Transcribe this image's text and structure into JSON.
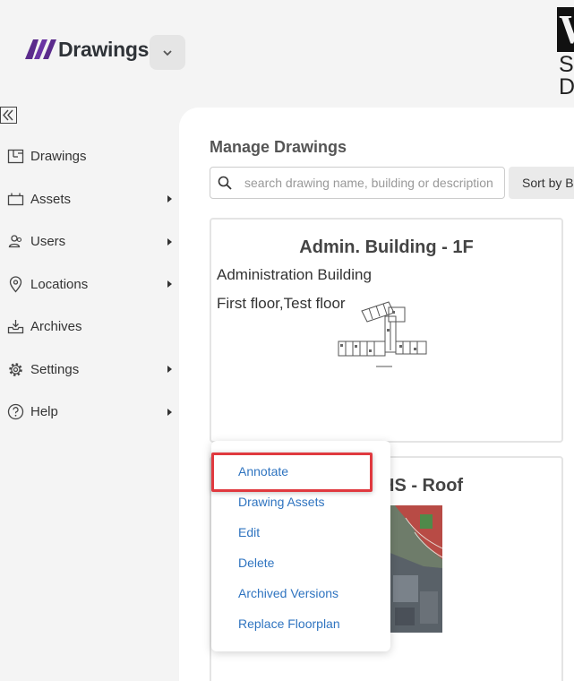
{
  "header": {
    "logo_text": "Drawings",
    "brand_letter": "W",
    "brand_line1": "S",
    "brand_line2": "D"
  },
  "sidebar": {
    "items": [
      {
        "label": "Drawings",
        "icon": "floorplan-icon",
        "has_submenu": false
      },
      {
        "label": "Assets",
        "icon": "assets-icon",
        "has_submenu": true
      },
      {
        "label": "Users",
        "icon": "users-icon",
        "has_submenu": true
      },
      {
        "label": "Locations",
        "icon": "location-pin-icon",
        "has_submenu": true
      },
      {
        "label": "Archives",
        "icon": "archive-tray-icon",
        "has_submenu": false
      },
      {
        "label": "Settings",
        "icon": "gear-icon",
        "has_submenu": true
      },
      {
        "label": "Help",
        "icon": "help-icon",
        "has_submenu": true
      }
    ]
  },
  "main": {
    "title": "Manage Drawings",
    "search": {
      "value": "",
      "placeholder": "search drawing name, building or description"
    },
    "sort_label": "Sort by B",
    "cards": [
      {
        "title": "Admin. Building - 1F",
        "building": "Administration Building",
        "description": "First floor,Test floor"
      },
      {
        "title": "HS - Roof"
      }
    ]
  },
  "context_menu": {
    "items": [
      "Annotate",
      "Drawing Assets",
      "Edit",
      "Delete",
      "Archived Versions",
      "Replace Floorplan"
    ],
    "highlighted": "Annotate"
  },
  "colors": {
    "logo_purple": "#5b2b8c",
    "link_blue": "#2f74c0",
    "highlight_red": "#e0393f",
    "background": "#f4f4f4"
  }
}
